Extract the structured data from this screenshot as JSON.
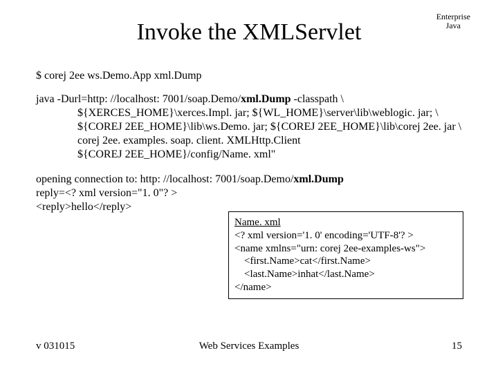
{
  "corner": {
    "line1": "Enterprise",
    "line2": "Java"
  },
  "title": "Invoke the XMLServlet",
  "cmd": "$ corej 2ee ws.Demo.App xml.Dump",
  "java": {
    "l1a": "java -Durl=http: //localhost: 7001/soap.Demo/",
    "l1b": "xml.Dump",
    "l1c": " -classpath \\",
    "l2": "${XERCES_HOME}\\xerces.Impl. jar; ${WL_HOME}\\server\\lib\\weblogic. jar; \\",
    "l3": "${COREJ 2EE_HOME}\\lib\\ws.Demo. jar; ${COREJ 2EE_HOME}\\lib\\corej 2ee. jar \\",
    "l4": "corej 2ee. examples. soap. client. XMLHttp.Client",
    "l5": "${COREJ 2EE_HOME}/config/Name. xml\""
  },
  "out": {
    "l1a": "opening connection to: http: //localhost: 7001/soap.Demo/",
    "l1b": "xml.Dump",
    "l2": "reply=<? xml version=\"1. 0\"? >",
    "l3": "<reply>hello</reply>"
  },
  "box": {
    "title": "Name. xml",
    "l1": "<? xml version='1. 0' encoding='UTF-8'? >",
    "l2": "<name xmlns=\"urn: corej 2ee-examples-ws\">",
    "l3": "<first.Name>cat</first.Name>",
    "l4": "<last.Name>inhat</last.Name>",
    "l5": "</name>"
  },
  "footer": {
    "left": "v 031015",
    "center": "Web Services Examples",
    "right": "15"
  }
}
